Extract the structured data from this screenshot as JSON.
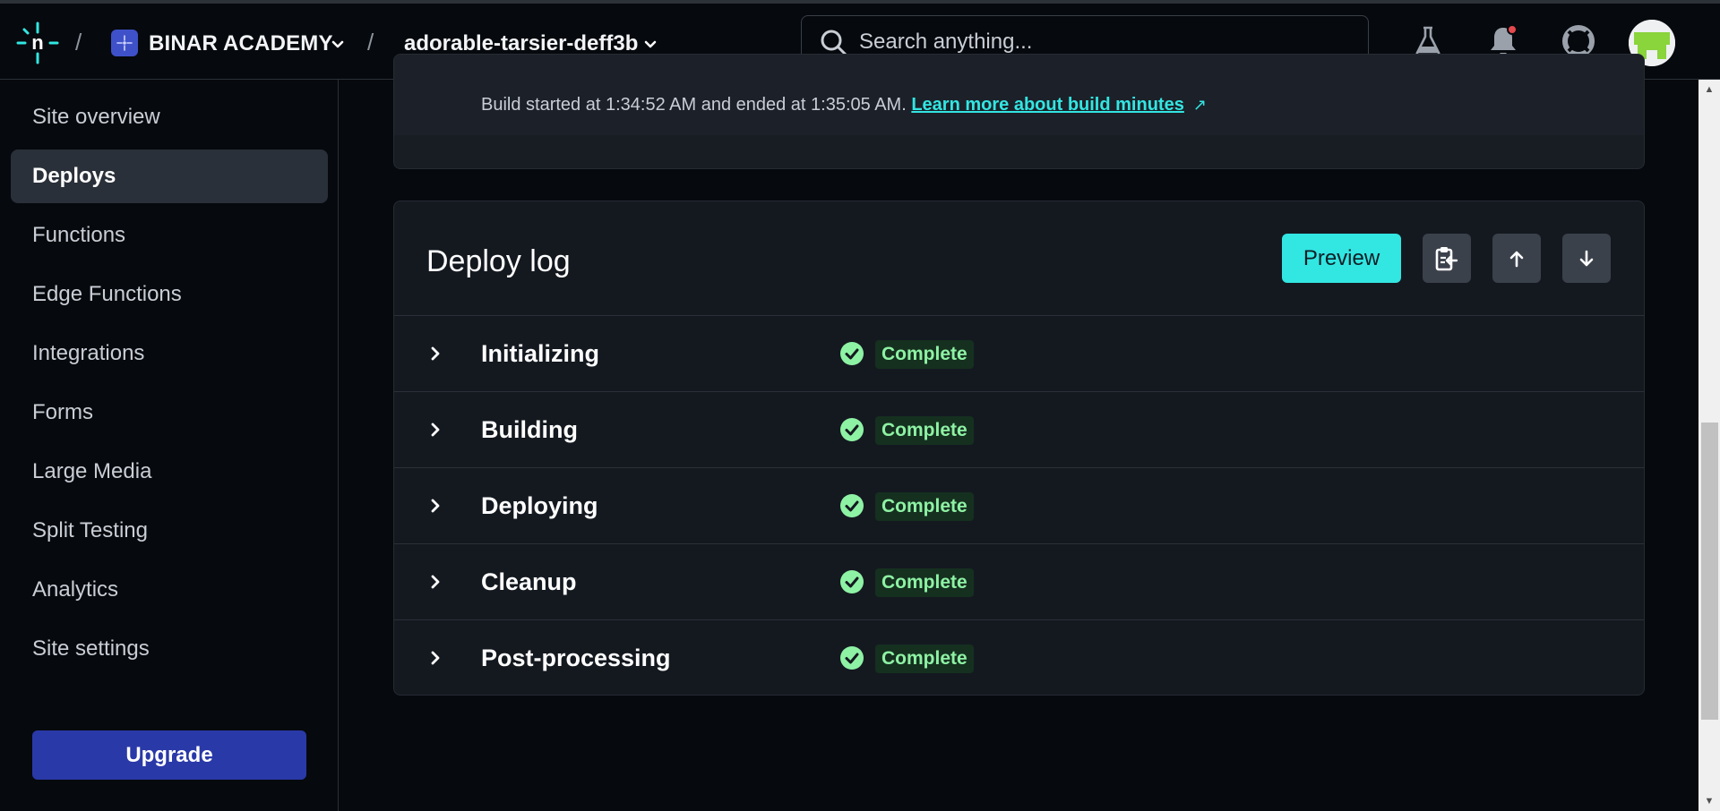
{
  "header": {
    "team_name": "BINAR ACADEMY",
    "site_name": "adorable-tarsier-deff3b",
    "search_placeholder": "Search anything...",
    "separator": "/"
  },
  "sidebar": {
    "items": [
      {
        "label": "Site overview",
        "active": false
      },
      {
        "label": "Deploys",
        "active": true
      },
      {
        "label": "Functions",
        "active": false
      },
      {
        "label": "Edge Functions",
        "active": false
      },
      {
        "label": "Integrations",
        "active": false
      },
      {
        "label": "Forms",
        "active": false
      },
      {
        "label": "Large Media",
        "active": false
      },
      {
        "label": "Split Testing",
        "active": false
      },
      {
        "label": "Analytics",
        "active": false
      },
      {
        "label": "Site settings",
        "active": false
      }
    ],
    "upgrade_label": "Upgrade"
  },
  "build_info": {
    "text": "Build started at 1:34:52 AM and ended at 1:35:05 AM.",
    "link_label": "Learn more about build minutes",
    "link_arrow": "↗"
  },
  "deploy_log": {
    "title": "Deploy log",
    "preview_label": "Preview",
    "steps": [
      {
        "name": "Initializing",
        "status": "Complete"
      },
      {
        "name": "Building",
        "status": "Complete"
      },
      {
        "name": "Deploying",
        "status": "Complete"
      },
      {
        "name": "Cleanup",
        "status": "Complete"
      },
      {
        "name": "Post-processing",
        "status": "Complete"
      }
    ]
  },
  "colors": {
    "accent": "#32e6e2",
    "success": "#8ef2a4",
    "upgrade": "#2a39a8",
    "notification_dot": "#e5484d"
  }
}
